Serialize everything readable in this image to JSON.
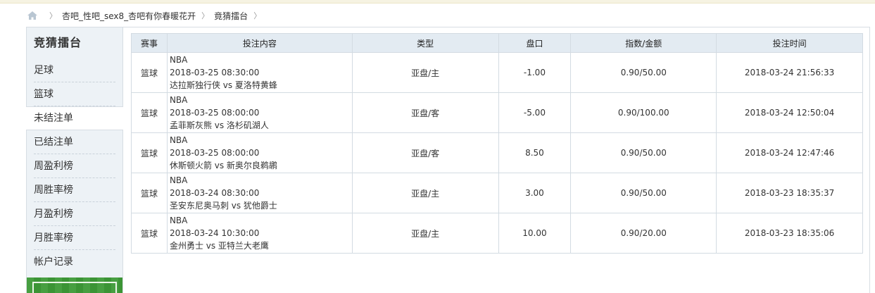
{
  "breadcrumb": {
    "home_icon": "home-icon",
    "items": [
      "杏吧_性吧_sex8_杏吧有你春暖花开",
      "竟猜擂台"
    ]
  },
  "sidebar": {
    "title": "竞猜擂台",
    "items": [
      {
        "label": "足球"
      },
      {
        "label": "篮球"
      },
      {
        "label": "未结注单",
        "active": true
      },
      {
        "label": "已结注单"
      },
      {
        "label": "周盈利榜"
      },
      {
        "label": "周胜率榜"
      },
      {
        "label": "月盈利榜"
      },
      {
        "label": "月胜率榜"
      },
      {
        "label": "帐户记录"
      }
    ]
  },
  "table": {
    "headers": [
      "赛事",
      "投注内容",
      "类型",
      "盘口",
      "指数/金额",
      "投注时间"
    ],
    "rows": [
      {
        "sport": "篮球",
        "league": "NBA",
        "match_time": "2018-03-25 08:30:00",
        "teams": "达拉斯独行侠 vs 夏洛特黄蜂",
        "type": "亚盘/主",
        "line": "-1.00",
        "odds_amount": "0.90/50.00",
        "bet_time": "2018-03-24 21:56:33"
      },
      {
        "sport": "篮球",
        "league": "NBA",
        "match_time": "2018-03-25 08:00:00",
        "teams": "孟菲斯灰熊 vs 洛杉矶湖人",
        "type": "亚盘/客",
        "line": "-5.00",
        "odds_amount": "0.90/100.00",
        "bet_time": "2018-03-24 12:50:04"
      },
      {
        "sport": "篮球",
        "league": "NBA",
        "match_time": "2018-03-25 08:00:00",
        "teams": "休斯顿火箭 vs 新奥尔良鹈鹕",
        "type": "亚盘/客",
        "line": "8.50",
        "odds_amount": "0.90/50.00",
        "bet_time": "2018-03-24 12:47:46"
      },
      {
        "sport": "篮球",
        "league": "NBA",
        "match_time": "2018-03-24 08:30:00",
        "teams": "圣安东尼奥马刺 vs 犹他爵士",
        "type": "亚盘/主",
        "line": "3.00",
        "odds_amount": "0.90/50.00",
        "bet_time": "2018-03-23 18:35:37"
      },
      {
        "sport": "篮球",
        "league": "NBA",
        "match_time": "2018-03-24 10:30:00",
        "teams": "金州勇士 vs 亚特兰大老鹰",
        "type": "亚盘/主",
        "line": "10.00",
        "odds_amount": "0.90/20.00",
        "bet_time": "2018-03-23 18:35:06"
      }
    ]
  },
  "colors": {
    "header_bg": "#e3ebf2",
    "sidebar_bg": "#edf2f6",
    "border": "#d3dbe2",
    "field_green": "#3d9a37"
  }
}
